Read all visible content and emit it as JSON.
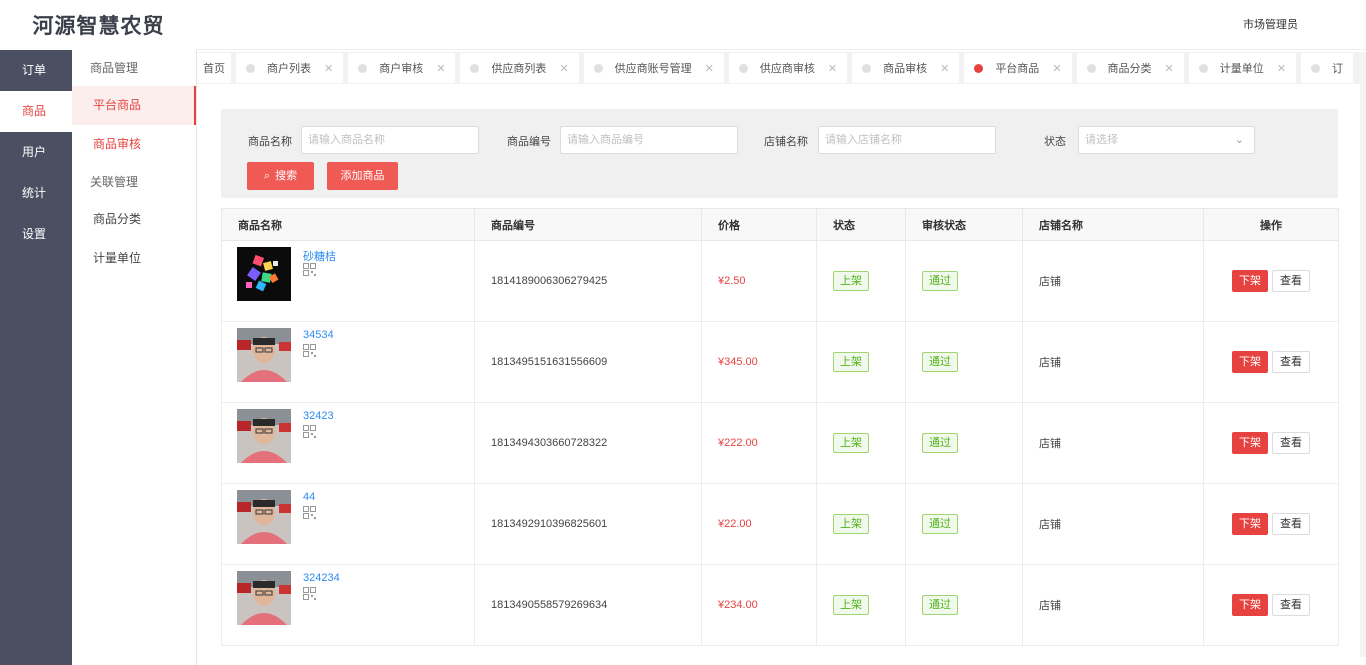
{
  "app": {
    "title": "河源智慧农贸",
    "user": "市场管理员"
  },
  "nav": {
    "main": [
      {
        "label": "订单"
      },
      {
        "label": "商品"
      },
      {
        "label": "用户"
      },
      {
        "label": "统计"
      },
      {
        "label": "设置"
      }
    ],
    "sub": {
      "group1": "商品管理",
      "item_platform": "平台商品",
      "item_audit": "商品审核",
      "group2": "关联管理",
      "item_category": "商品分类",
      "item_unit": "计量单位"
    }
  },
  "tabs": [
    {
      "label": "首页"
    },
    {
      "label": "商户列表"
    },
    {
      "label": "商户审核"
    },
    {
      "label": "供应商列表"
    },
    {
      "label": "供应商账号管理"
    },
    {
      "label": "供应商审核"
    },
    {
      "label": "商品审核"
    },
    {
      "label": "平台商品"
    },
    {
      "label": "商品分类"
    },
    {
      "label": "计量单位"
    },
    {
      "label": "订"
    }
  ],
  "filter": {
    "name_label": "商品名称",
    "name_placeholder": "请输入商品名称",
    "code_label": "商品编号",
    "code_placeholder": "请输入商品编号",
    "shop_label": "店铺名称",
    "shop_placeholder": "请输入店铺名称",
    "status_label": "状态",
    "status_placeholder": "请选择",
    "search_btn": "搜索",
    "add_btn": "添加商品"
  },
  "table": {
    "headers": [
      "商品名称",
      "商品编号",
      "价格",
      "状态",
      "审核状态",
      "店铺名称",
      "操作"
    ],
    "rows": [
      {
        "name": "砂糖桔",
        "code": "1814189006306279425",
        "price": "¥2.50",
        "status": "上架",
        "audit": "通过",
        "shop": "店铺",
        "btn_down": "下架",
        "btn_view": "查看"
      },
      {
        "name": "34534",
        "code": "1813495151631556609",
        "price": "¥345.00",
        "status": "上架",
        "audit": "通过",
        "shop": "店铺",
        "btn_down": "下架",
        "btn_view": "查看"
      },
      {
        "name": "32423",
        "code": "1813494303660728322",
        "price": "¥222.00",
        "status": "上架",
        "audit": "通过",
        "shop": "店铺",
        "btn_down": "下架",
        "btn_view": "查看"
      },
      {
        "name": "44",
        "code": "1813492910396825601",
        "price": "¥22.00",
        "status": "上架",
        "audit": "通过",
        "shop": "店铺",
        "btn_down": "下架",
        "btn_view": "查看"
      },
      {
        "name": "324234",
        "code": "1813490558579269634",
        "price": "¥234.00",
        "status": "上架",
        "audit": "通过",
        "shop": "店铺",
        "btn_down": "下架",
        "btn_view": "查看"
      }
    ]
  }
}
